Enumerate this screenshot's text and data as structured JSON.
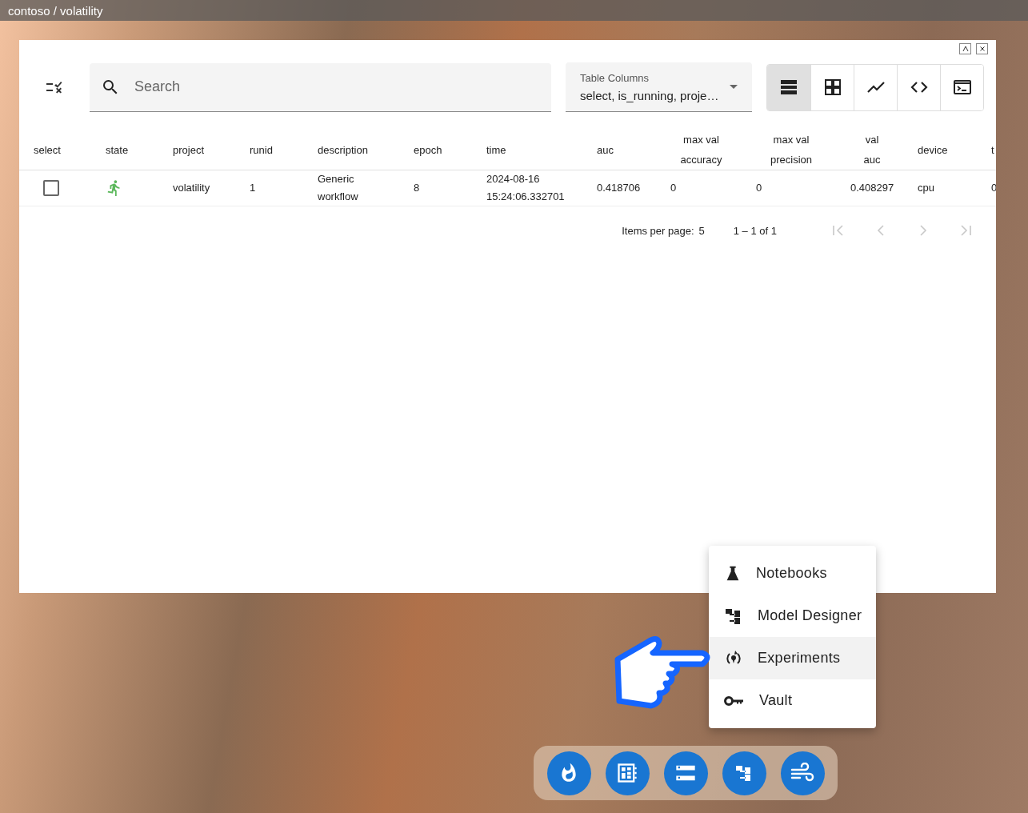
{
  "top_bar": {
    "title": "contoso / volatility"
  },
  "window": {
    "controls": [
      {
        "kind": "collapse"
      },
      {
        "kind": "close"
      }
    ]
  },
  "toolbar": {
    "search": {
      "placeholder": "Search"
    },
    "columns_select": {
      "label": "Table Columns",
      "value": "select, is_running, proje…"
    },
    "views": [
      {
        "kind": "list",
        "selected": true
      },
      {
        "kind": "grid",
        "selected": false
      },
      {
        "kind": "chart",
        "selected": false
      },
      {
        "kind": "code",
        "selected": false
      },
      {
        "kind": "terminal",
        "selected": false
      }
    ]
  },
  "table": {
    "columns": [
      "select",
      "state",
      "project",
      "runid",
      "description",
      "epoch",
      "time",
      "auc",
      "max val\naccuracy",
      "max val\nprecision",
      "val\nauc",
      "device",
      "t"
    ],
    "rows": [
      {
        "cells": [
          {
            "kind": "checkbox",
            "checked": false
          },
          {
            "kind": "state",
            "running": true
          },
          {
            "kind": "text",
            "text": "volatility"
          },
          {
            "kind": "text",
            "text": "1"
          },
          {
            "kind": "text",
            "text": "Generic\nworkflow"
          },
          {
            "kind": "text",
            "text": "8"
          },
          {
            "kind": "text",
            "text": "2024-08-16\n15:24:06.332701"
          },
          {
            "kind": "text",
            "text": "0.418706"
          },
          {
            "kind": "text",
            "text": "0"
          },
          {
            "kind": "text",
            "text": "0"
          },
          {
            "kind": "text",
            "text": "0.408297"
          },
          {
            "kind": "text",
            "text": "cpu"
          },
          {
            "kind": "text",
            "text": "0"
          }
        ]
      }
    ]
  },
  "paginator": {
    "label": "Items per page:",
    "page_size": "5",
    "range": "1 – 1 of 1",
    "first_disabled": true,
    "prev_disabled": true,
    "next_disabled": true,
    "last_disabled": true
  },
  "menu": {
    "items": [
      {
        "kind": "flask",
        "label": "Notebooks",
        "selected": false
      },
      {
        "kind": "tree",
        "label": "Model Designer",
        "selected": false
      },
      {
        "kind": "experiment",
        "label": "Experiments",
        "selected": true
      },
      {
        "kind": "key",
        "label": "Vault",
        "selected": false
      }
    ]
  },
  "pointer": {
    "kind": "hand"
  },
  "dock": [
    {
      "kind": "fire"
    },
    {
      "kind": "dashboard"
    },
    {
      "kind": "storage"
    },
    {
      "kind": "tree"
    },
    {
      "kind": "wind"
    }
  ]
}
